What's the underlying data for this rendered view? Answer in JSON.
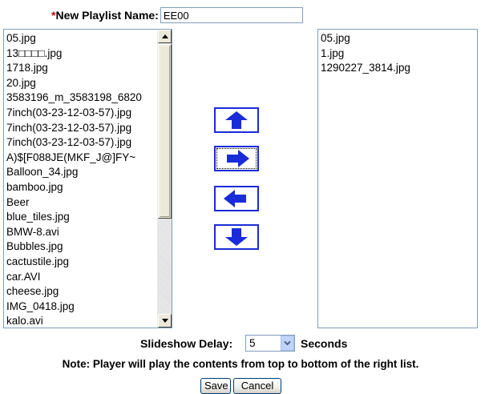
{
  "playlist": {
    "required_mark": "*",
    "name_label": "New Playlist Name:",
    "name_value": "EE00"
  },
  "left_list": {
    "items": [
      "05.jpg",
      "13□□□□.jpg",
      "1718.jpg",
      "20.jpg",
      "3583196_m_3583198_6820",
      "7inch(03-23-12-03-57).jpg",
      "7inch(03-23-12-03-57).jpg",
      "7inch(03-23-12-03-57).jpg",
      "A)$[F088JE(MKF_J@]FY~",
      "Balloon_34.jpg",
      "bamboo.jpg",
      "Beer",
      "blue_tiles.jpg",
      "BMW-8.avi",
      "Bubbles.jpg",
      "cactustile.jpg",
      "car.AVI",
      "cheese.jpg",
      "IMG_0418.jpg",
      "kalo.avi"
    ]
  },
  "right_list": {
    "items": [
      "05.jpg",
      "1.jpg",
      "1290227_3814.jpg"
    ]
  },
  "arrow_buttons": {
    "color": "#1a2bd8",
    "icons": [
      "arrow-up-icon",
      "arrow-right-icon",
      "arrow-left-icon",
      "arrow-down-icon"
    ]
  },
  "slideshow": {
    "label": "Slideshow Delay:",
    "value": "5",
    "unit": "Seconds"
  },
  "note": "Note: Player will play the contents from top to bottom of the right list.",
  "actions": {
    "save": "Save",
    "cancel": "Cancel"
  },
  "colors": {
    "required": "#cc0000",
    "border": "#7f9db9"
  }
}
